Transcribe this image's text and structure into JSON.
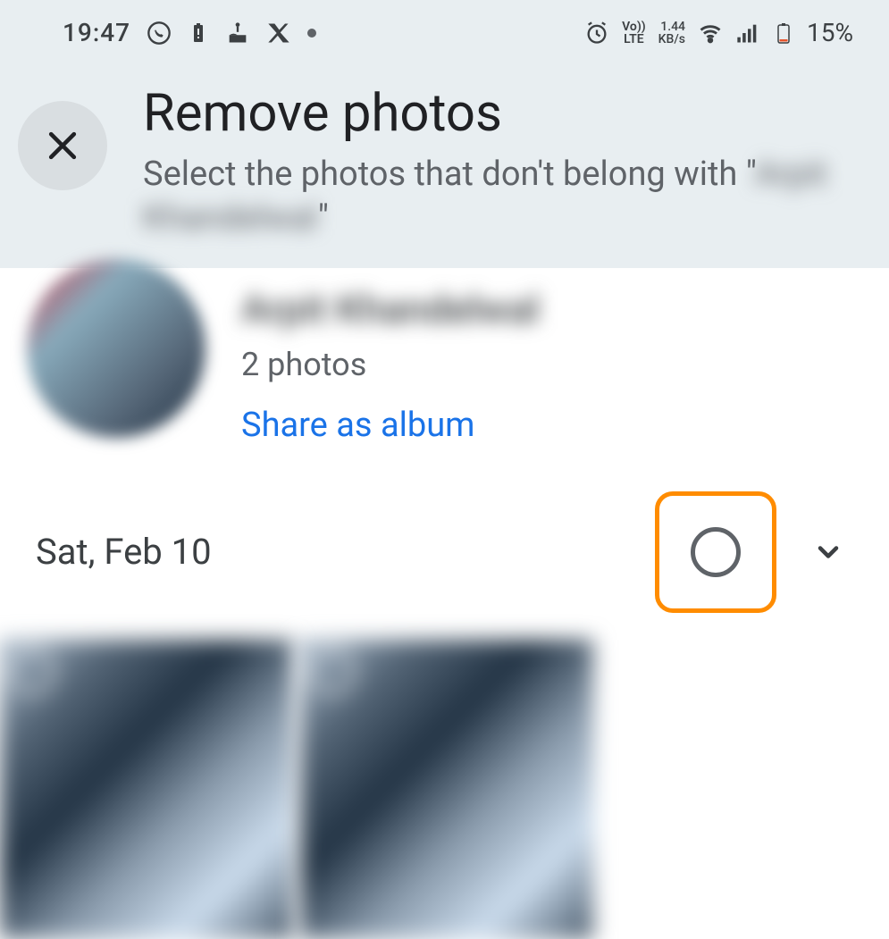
{
  "status_bar": {
    "time": "19:47",
    "net_top": "Vo))",
    "net_bottom": "LTE",
    "speed_top": "1.44",
    "speed_bottom": "KB/s",
    "battery_percent": "15%"
  },
  "header": {
    "title": "Remove photos",
    "subtitle_prefix": "Select the photos that don't belong with \"",
    "subtitle_name": "Arpit Khandelwal",
    "subtitle_suffix": "\""
  },
  "person": {
    "name": "Arpit Khandelwal",
    "photo_count": "2 photos",
    "share_action": "Share as album"
  },
  "date_section": {
    "label": "Sat, Feb 10"
  }
}
